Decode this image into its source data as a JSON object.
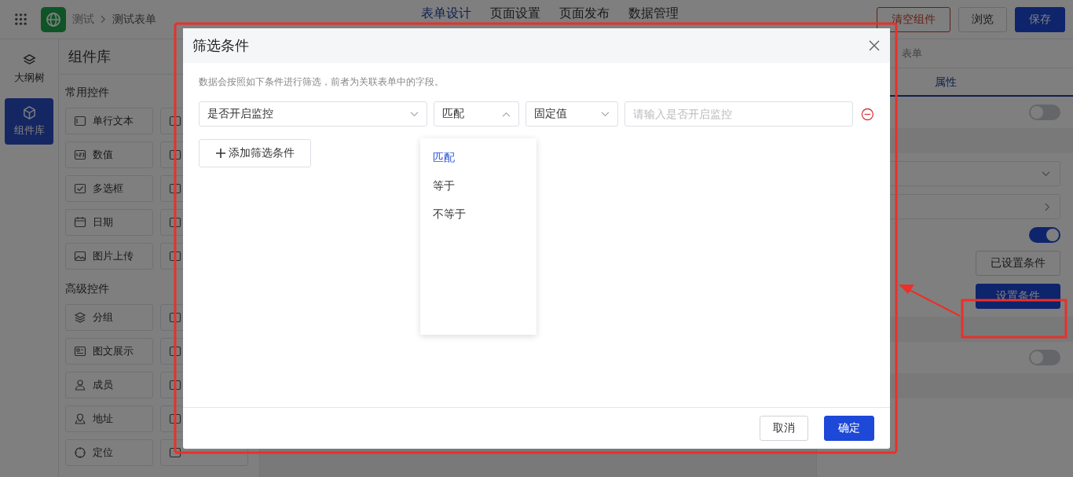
{
  "header": {
    "breadcrumb": [
      "测试",
      "测试表单"
    ],
    "nav": [
      {
        "label": "表单设计",
        "selected": true
      },
      {
        "label": "页面设置",
        "selected": false
      },
      {
        "label": "页面发布",
        "selected": false
      },
      {
        "label": "数据管理",
        "selected": false
      }
    ],
    "buttons": [
      {
        "label": "清空组件",
        "kind": "danger"
      },
      {
        "label": "浏览",
        "kind": "default"
      },
      {
        "label": "保存",
        "kind": "primary"
      }
    ]
  },
  "rail": [
    {
      "label": "大纲树",
      "selected": false
    },
    {
      "label": "组件库",
      "selected": true
    }
  ],
  "library": {
    "title": "组件库",
    "groups": [
      {
        "title": "常用控件",
        "items": [
          "单行文本",
          "数值",
          "多选框",
          "日期",
          "图片上传"
        ]
      },
      {
        "title": "高级控件",
        "items": [
          "分组",
          "图文展示",
          "成员",
          "地址",
          "定位"
        ]
      }
    ]
  },
  "properties": {
    "title": "表单",
    "tabs": [
      {
        "label": "属性",
        "selected": true
      }
    ],
    "rows": [
      {
        "kind": "toggle",
        "on": false
      },
      {
        "kind": "band"
      },
      {
        "kind": "select"
      },
      {
        "kind": "link"
      },
      {
        "kind": "toggle",
        "on": true
      },
      {
        "kind": "button",
        "label": "已设置条件"
      },
      {
        "kind": "primary",
        "label": "设置条件"
      },
      {
        "kind": "band"
      },
      {
        "kind": "toggle",
        "on": false
      },
      {
        "kind": "band"
      }
    ]
  },
  "dialog": {
    "title": "筛选条件",
    "description": "数据会按照如下条件进行筛选，前者为关联表单中的字段。",
    "conditions": [
      {
        "field": "是否开启监控",
        "operator": "匹配",
        "expanded": true,
        "value_type": "固定值",
        "placeholder": "请输入是否开启监控"
      }
    ],
    "add_button": "添加筛选条件",
    "options": [
      {
        "label": "匹配",
        "selected": true
      },
      {
        "label": "等于",
        "selected": false
      },
      {
        "label": "不等于",
        "selected": false
      }
    ],
    "buttons": [
      {
        "label": "取消",
        "kind": "default"
      },
      {
        "label": "确定",
        "kind": "primary"
      }
    ]
  }
}
